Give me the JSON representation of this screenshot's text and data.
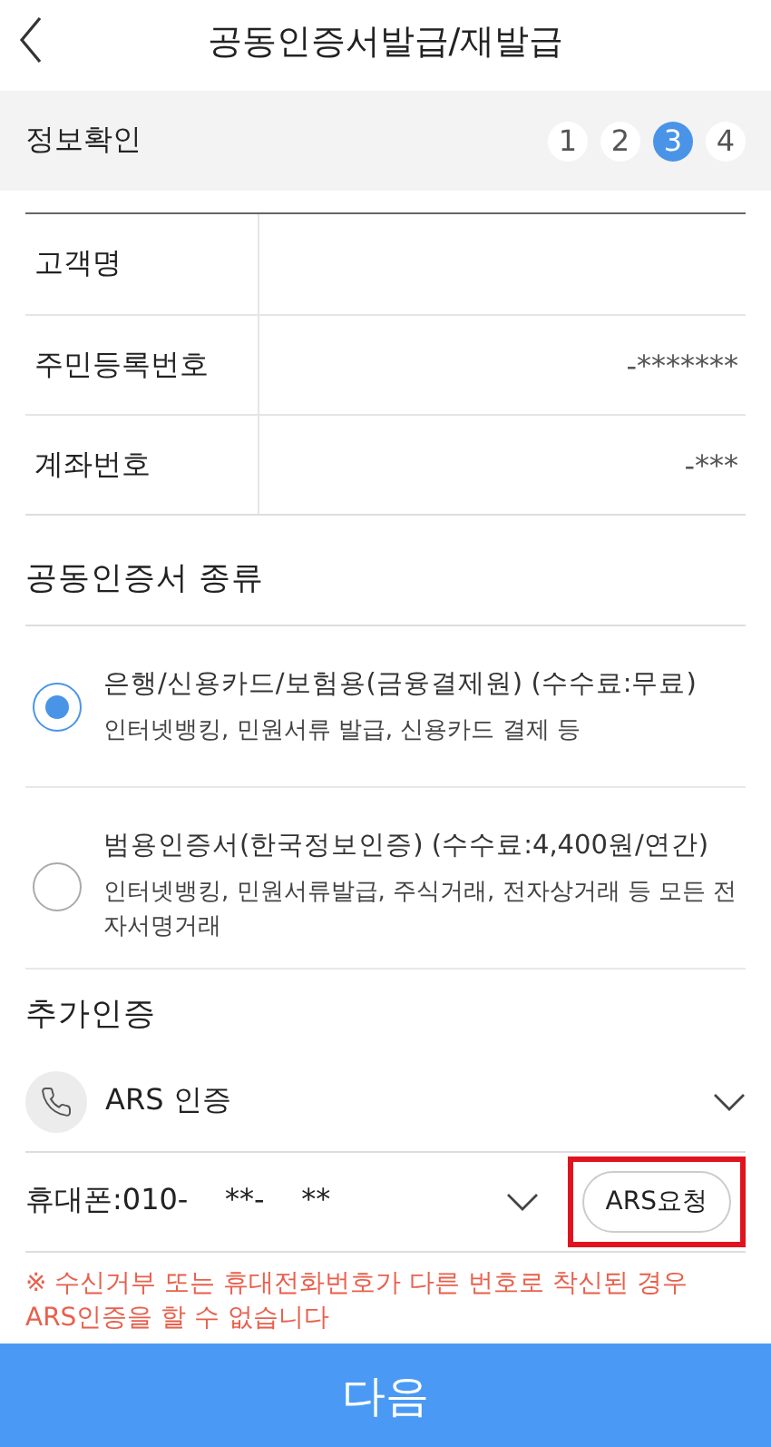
{
  "header": {
    "title": "공동인증서발급/재발급"
  },
  "steps": {
    "label": "정보확인",
    "items": [
      {
        "label": "1",
        "selected": false
      },
      {
        "label": "2",
        "selected": false
      },
      {
        "label": "3",
        "selected": true
      },
      {
        "label": "4",
        "selected": false
      }
    ]
  },
  "info_rows": [
    {
      "label": "고객명"
    },
    {
      "label": "주민등록번호",
      "value": "-*******"
    },
    {
      "label": "계좌번호",
      "value": "-***"
    }
  ],
  "certificate_type": {
    "title": "공동인증서 종류",
    "options": [
      {
        "title": "은행/신용카드/보험용(금융결제원) (수수료:무료)",
        "description": "인터넷뱅킹, 민원서류 발급, 신용카드 결제 등",
        "selected": true
      },
      {
        "title": "범용인증서(한국정보인증) (수수료:4,400원/연간)",
        "description": "인터넷뱅킹, 민원서류발급, 주식거래, 전자상거래 등 모든 전자서명거래",
        "selected": false
      }
    ]
  },
  "additional_auth": {
    "title": "추가인증",
    "method": "ARS 인증",
    "phone_label": "휴대폰:",
    "phone_value": "010-    **-    **",
    "request_button": "ARS요청",
    "highlighted": true,
    "notice": "※ 수신거부 또는 휴대전화번호가 다른 번호로 착신된 경우 ARS인증을 할 수 없습니다"
  },
  "next_button": "다음"
}
